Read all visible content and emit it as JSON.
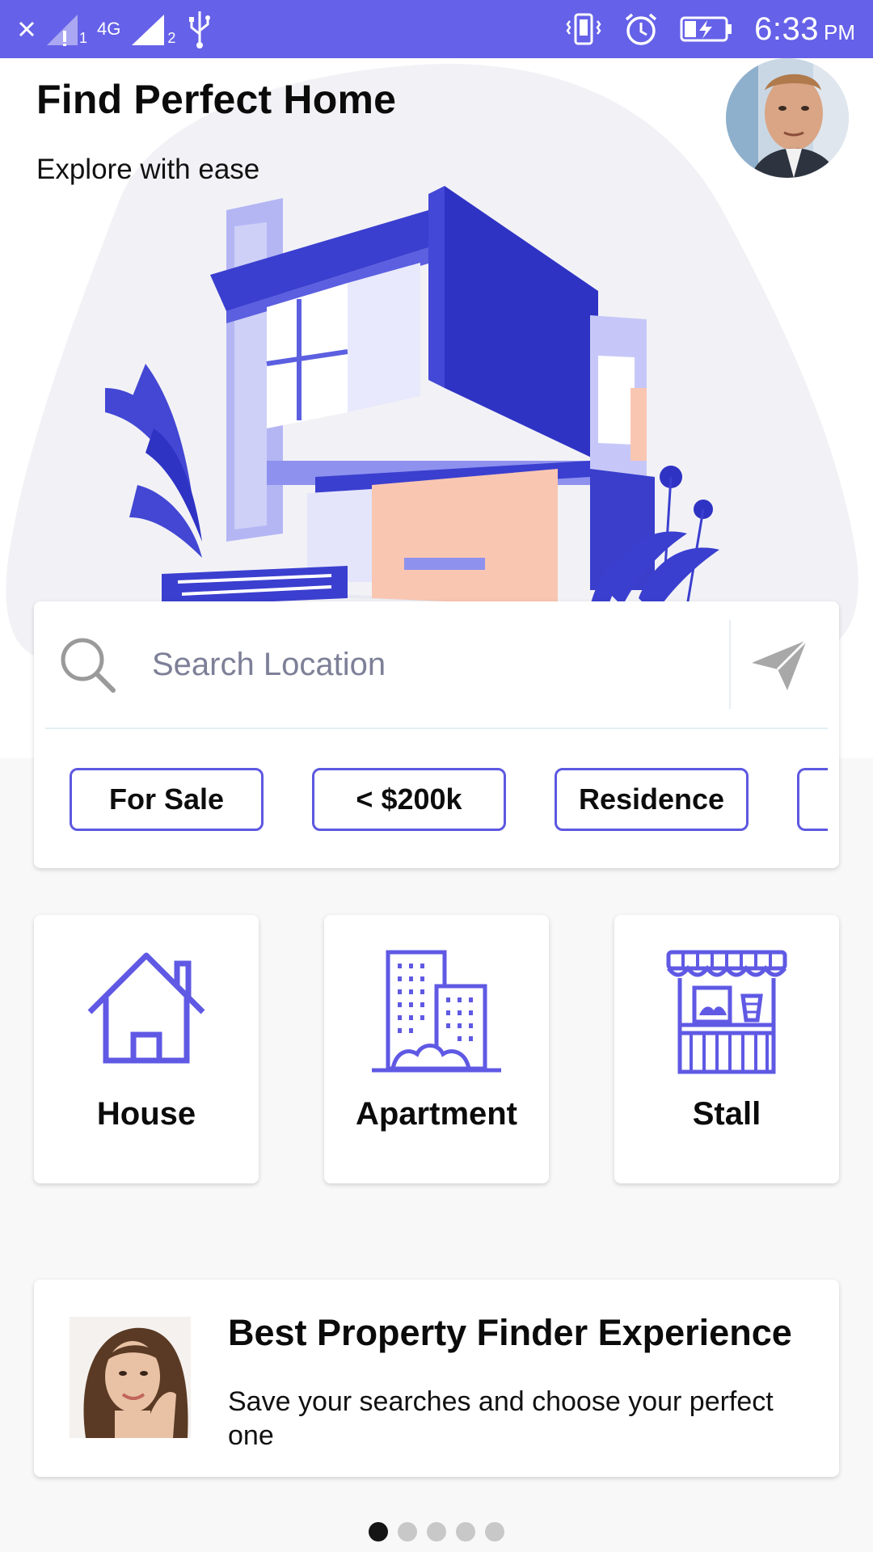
{
  "status_bar": {
    "network_type": "4G",
    "sim2_label": "2",
    "sim1_label": "1",
    "time": "6:33",
    "ampm": "PM"
  },
  "header": {
    "title": "Find Perfect Home",
    "subtitle": "Explore with ease"
  },
  "search": {
    "placeholder": "Search Location",
    "value": ""
  },
  "filters": [
    {
      "label": "For Sale"
    },
    {
      "label": "< $200k"
    },
    {
      "label": "Residence"
    }
  ],
  "categories": [
    {
      "label": "House",
      "icon": "house-icon"
    },
    {
      "label": "Apartment",
      "icon": "apartment-building-icon"
    },
    {
      "label": "Stall",
      "icon": "market-stall-icon"
    }
  ],
  "promo": {
    "title": "Best Property Finder Experience",
    "text": "Save your searches and choose your perfect one"
  },
  "pager": {
    "count": 5,
    "active_index": 0
  },
  "colors": {
    "accent": "#6561e8",
    "chip_border": "#5d58e0",
    "peach": "#f9c6b2",
    "blob": "#f2f2f6"
  }
}
